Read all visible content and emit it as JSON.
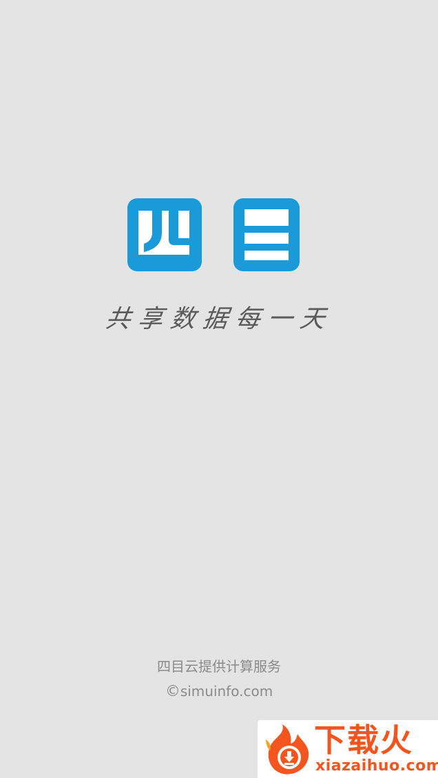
{
  "logo": {
    "text": "四目",
    "color": "#1a9ad8"
  },
  "slogan": "共享数据每一天",
  "footer": {
    "provider": "四目云提供计算服务",
    "copyright_symbol": "©",
    "domain": "simuinfo.com"
  },
  "watermark": {
    "title": "下载火",
    "domain": "xiazaihuo.com",
    "icon": "flame-download-icon",
    "color": "#f4541d"
  },
  "colors": {
    "background": "#e4e4e4",
    "slogan": "#5a5a5a",
    "footer_text": "#8a8a8a"
  }
}
